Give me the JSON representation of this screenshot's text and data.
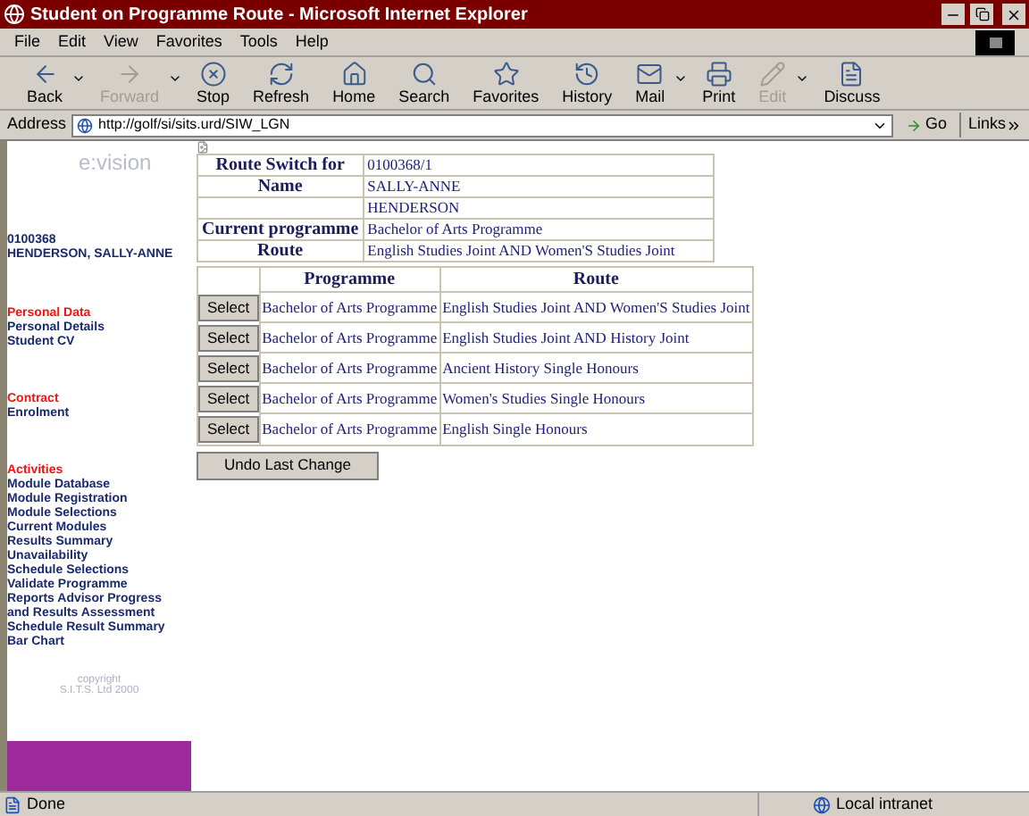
{
  "window": {
    "title": "Student on Programme Route - Microsoft Internet Explorer"
  },
  "menu": [
    "File",
    "Edit",
    "View",
    "Favorites",
    "Tools",
    "Help"
  ],
  "toolbar": [
    {
      "kind": "back",
      "label": "Back",
      "disabled": false,
      "dropdown": true
    },
    {
      "kind": "forward",
      "label": "Forward",
      "disabled": true,
      "dropdown": true
    },
    {
      "kind": "stop",
      "label": "Stop",
      "disabled": false,
      "dropdown": false
    },
    {
      "kind": "refresh",
      "label": "Refresh",
      "disabled": false,
      "dropdown": false
    },
    {
      "kind": "home",
      "label": "Home",
      "disabled": false,
      "dropdown": false
    },
    {
      "kind": "search",
      "label": "Search",
      "disabled": false,
      "dropdown": false
    },
    {
      "kind": "favorites",
      "label": "Favorites",
      "disabled": false,
      "dropdown": false
    },
    {
      "kind": "history",
      "label": "History",
      "disabled": false,
      "dropdown": false
    },
    {
      "kind": "mail",
      "label": "Mail",
      "disabled": false,
      "dropdown": true
    },
    {
      "kind": "print",
      "label": "Print",
      "disabled": false,
      "dropdown": false
    },
    {
      "kind": "edit",
      "label": "Edit",
      "disabled": true,
      "dropdown": true
    },
    {
      "kind": "discuss",
      "label": "Discuss",
      "disabled": false,
      "dropdown": false
    }
  ],
  "address": {
    "label": "Address",
    "value": "http://golf/si/sits.urd/SIW_LGN",
    "go": "Go",
    "links": "Links"
  },
  "sidebar": {
    "logo": "e:vision",
    "student_id": "0100368",
    "student_name": "HENDERSON, SALLY-ANNE",
    "sections": [
      {
        "heading": "Personal Data",
        "items": [
          "Personal Details",
          "Student CV"
        ]
      },
      {
        "heading": "Contract",
        "items": [
          "Enrolment"
        ]
      },
      {
        "heading": "Activities",
        "items": [
          "Module Database",
          "Module Registration",
          "Module Selections",
          "Current Modules",
          "Results Summary",
          "Unavailability",
          "Schedule Selections",
          "Validate Programme",
          "Reports Advisor Progress",
          "and Results Assessment",
          "Schedule Result Summary",
          "Bar Chart"
        ]
      }
    ],
    "copyright": [
      "copyright",
      "S.I.T.S. Ltd 2000"
    ]
  },
  "info": [
    {
      "label": "Route Switch for",
      "value": "0100368/1"
    },
    {
      "label": "Name",
      "value": "SALLY-ANNE"
    },
    {
      "value": "HENDERSON"
    },
    {
      "label": "Current programme",
      "value": "Bachelor of Arts Programme"
    },
    {
      "label": "Route",
      "value": "English Studies Joint AND Women'S Studies Joint"
    }
  ],
  "routes": {
    "columns": [
      "Programme",
      "Route"
    ],
    "rows": [
      {
        "button": "Select",
        "programme": "Bachelor of Arts Programme",
        "route": "English Studies Joint AND Women'S Studies Joint"
      },
      {
        "button": "Select",
        "programme": "Bachelor of Arts Programme",
        "route": "English Studies Joint AND History Joint"
      },
      {
        "button": "Select",
        "programme": "Bachelor of Arts Programme",
        "route": "Ancient History Single Honours"
      },
      {
        "button": "Select",
        "programme": "Bachelor of Arts Programme",
        "route": "Women's Studies Single Honours"
      },
      {
        "button": "Select",
        "programme": "Bachelor of Arts Programme",
        "route": "English Single Honours"
      }
    ]
  },
  "undo": "Undo Last Change",
  "status_bar": {
    "text": "Done",
    "zone": "Local intranet"
  }
}
